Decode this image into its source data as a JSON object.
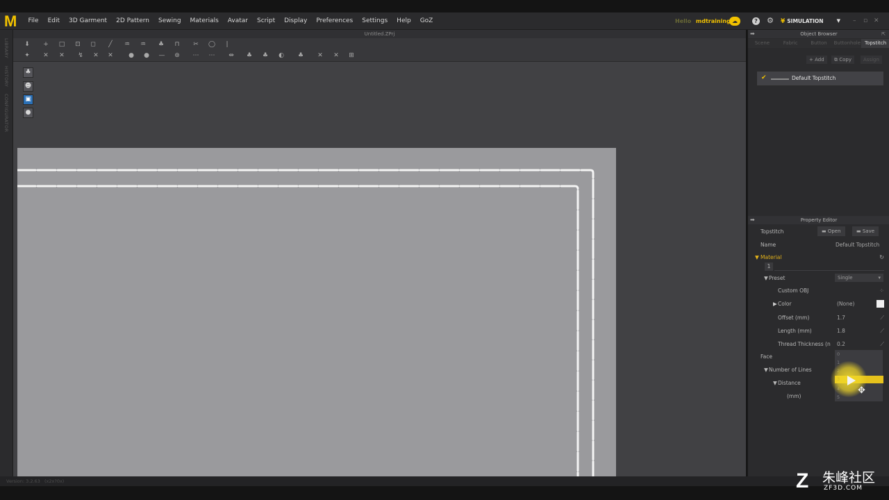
{
  "app": {
    "menu": [
      "File",
      "Edit",
      "3D Garment",
      "2D Pattern",
      "Sewing",
      "Materials",
      "Avatar",
      "Script",
      "Display",
      "Preferences",
      "Settings",
      "Help",
      "GoZ"
    ],
    "user_prefix": "Hello",
    "user_name": "mdtraining",
    "mode": "SIMULATION",
    "doc_title": "Untitled.ZPrj",
    "left_labels": [
      "LIBRARY",
      "HISTORY",
      "CONFIGURATOR"
    ],
    "accent": "#f2c200"
  },
  "object_browser": {
    "title": "Object Browser",
    "tabs": [
      "Scene",
      "Fabric",
      "Button",
      "Buttonhole",
      "Topstitch"
    ],
    "active_tab": "Topstitch",
    "add_label": "+ Add",
    "copy_label": "Copy",
    "assign_label": "Assign",
    "items": [
      "Default Topstitch"
    ]
  },
  "property_editor": {
    "title": "Property Editor",
    "type_label": "Topstitch",
    "open_label": "Open",
    "save_label": "Save",
    "name_label": "Name",
    "name_value": "Default Topstitch",
    "material_label": "Material",
    "material_tab": "1",
    "preset_label": "Preset",
    "preset_value": "Single",
    "custom_obj_label": "Custom OBJ",
    "color_label": "Color",
    "color_value": "(None)",
    "offset_label": "Offset (mm)",
    "offset_value": "1.7",
    "length_label": "Length (mm)",
    "length_value": "1.8",
    "thickness_label": "Thread Thickness (n",
    "thickness_value": "0.2",
    "face_label": "Face",
    "lines_label": "Number of Lines",
    "distance_label": "Distance",
    "distance_unit_label": "(mm)",
    "dropdown_options": [
      "0",
      "1",
      "2",
      "3",
      "4",
      "5"
    ]
  },
  "status": {
    "left": "Version: 3.2.63",
    "right": "(x2x?0x)"
  },
  "watermark": {
    "cn": "朱峰社区",
    "url": "ZF3D.COM"
  }
}
